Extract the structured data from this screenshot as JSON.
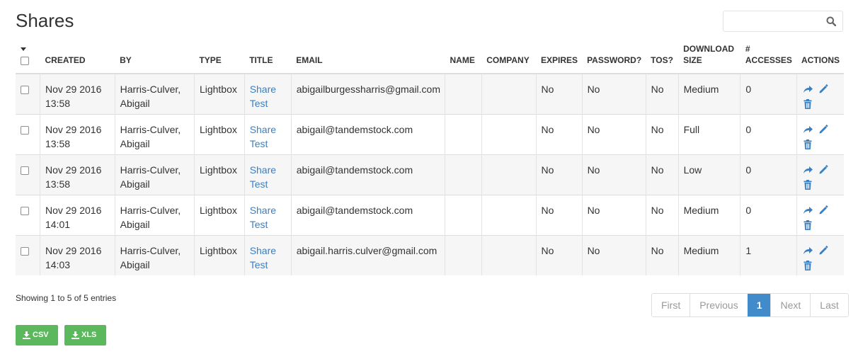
{
  "page": {
    "title": "Shares"
  },
  "search": {
    "placeholder": "",
    "value": ""
  },
  "table": {
    "headers": {
      "created": "CREATED",
      "by": "BY",
      "type": "TYPE",
      "title": "TITLE",
      "email": "EMAIL",
      "name": "NAME",
      "company": "COMPANY",
      "expires": "EXPIRES",
      "password": "PASSWORD?",
      "tos": "TOS?",
      "download_size_1": "DOWNLOAD",
      "download_size_2": "SIZE",
      "accesses_1": "#",
      "accesses_2": "ACCESSES",
      "actions": "ACTIONS"
    },
    "rows": [
      {
        "created_date": "Nov 29 2016",
        "created_time": "13:58",
        "by_1": "Harris-Culver,",
        "by_2": "Abigail",
        "type": "Lightbox",
        "title_1": "Share",
        "title_2": "Test",
        "email": "abigailburgessharris@gmail.com",
        "name": "",
        "company": "",
        "expires": "No",
        "password": "No",
        "tos": "No",
        "download_size": "Medium",
        "accesses": "0"
      },
      {
        "created_date": "Nov 29 2016",
        "created_time": "13:58",
        "by_1": "Harris-Culver,",
        "by_2": "Abigail",
        "type": "Lightbox",
        "title_1": "Share",
        "title_2": "Test",
        "email": "abigail@tandemstock.com",
        "name": "",
        "company": "",
        "expires": "No",
        "password": "No",
        "tos": "No",
        "download_size": "Full",
        "accesses": "0"
      },
      {
        "created_date": "Nov 29 2016",
        "created_time": "13:58",
        "by_1": "Harris-Culver,",
        "by_2": "Abigail",
        "type": "Lightbox",
        "title_1": "Share",
        "title_2": "Test",
        "email": "abigail@tandemstock.com",
        "name": "",
        "company": "",
        "expires": "No",
        "password": "No",
        "tos": "No",
        "download_size": "Low",
        "accesses": "0"
      },
      {
        "created_date": "Nov 29 2016",
        "created_time": "14:01",
        "by_1": "Harris-Culver,",
        "by_2": "Abigail",
        "type": "Lightbox",
        "title_1": "Share",
        "title_2": "Test",
        "email": "abigail@tandemstock.com",
        "name": "",
        "company": "",
        "expires": "No",
        "password": "No",
        "tos": "No",
        "download_size": "Medium",
        "accesses": "0"
      },
      {
        "created_date": "Nov 29 2016",
        "created_time": "14:03",
        "by_1": "Harris-Culver,",
        "by_2": "Abigail",
        "type": "Lightbox",
        "title_1": "Share",
        "title_2": "Test",
        "email": "abigail.harris.culver@gmail.com",
        "name": "",
        "company": "",
        "expires": "No",
        "password": "No",
        "tos": "No",
        "download_size": "Medium",
        "accesses": "1"
      }
    ]
  },
  "footer": {
    "showing": "Showing 1 to 5 of 5 entries",
    "pagination": {
      "first": "First",
      "previous": "Previous",
      "current": "1",
      "next": "Next",
      "last": "Last"
    },
    "export": {
      "csv": "CSV",
      "xls": "XLS"
    }
  },
  "icons": {
    "search": "search-icon",
    "share": "share-icon",
    "edit": "pencil-icon",
    "delete": "trash-icon",
    "download": "download-icon"
  },
  "colors": {
    "link": "#3a7fc1",
    "active_page": "#428bca",
    "export_button": "#5cb85c",
    "row_stripe": "#f6f6f6"
  }
}
